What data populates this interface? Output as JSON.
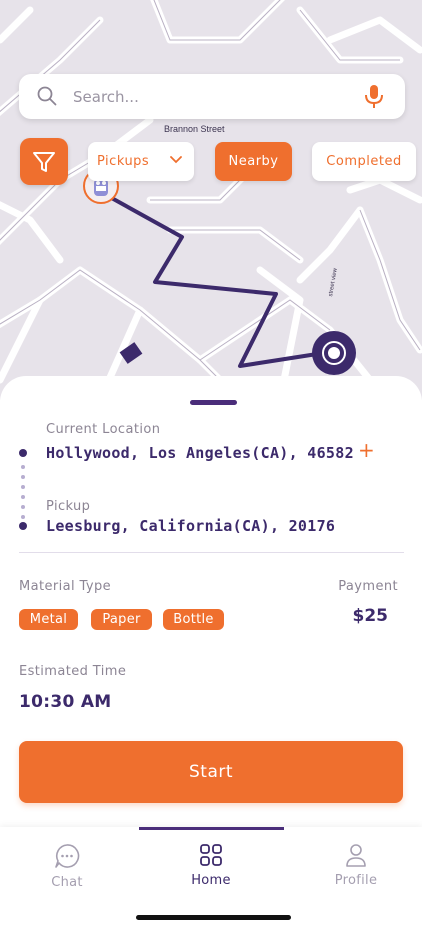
{
  "map": {
    "street_label": "Brannon Street",
    "street_label_2": "street view"
  },
  "search": {
    "placeholder": "Search...",
    "search_icon": "search-icon",
    "mic_icon": "microphone-icon"
  },
  "filters": {
    "filter_icon": "filter-icon",
    "pickups_label": "Pickups",
    "nearby_label": "Nearby",
    "completed_label": "Completed",
    "accent_color": "#ef6f2e"
  },
  "route": {
    "current_location_label": "Current Location",
    "current_location_value": "Hollywood, Los Angeles(CA), 46582",
    "pickup_label": "Pickup",
    "pickup_value": "Leesburg, California(CA), 20176"
  },
  "details": {
    "material_label": "Material Type",
    "materials": [
      "Metal",
      "Paper",
      "Bottle"
    ],
    "payment_label": "Payment",
    "payment_value": "$25",
    "time_label": "Estimated Time",
    "time_value": "10:30 AM"
  },
  "actions": {
    "start_label": "Start"
  },
  "tabs": [
    {
      "label": "Chat",
      "icon": "chat-icon"
    },
    {
      "label": "Home",
      "icon": "grid-icon"
    },
    {
      "label": "Profile",
      "icon": "user-icon"
    }
  ],
  "colors": {
    "primary": "#3c2a6b",
    "accent": "#ef6f2e",
    "map_bg": "#e7e3ea"
  }
}
